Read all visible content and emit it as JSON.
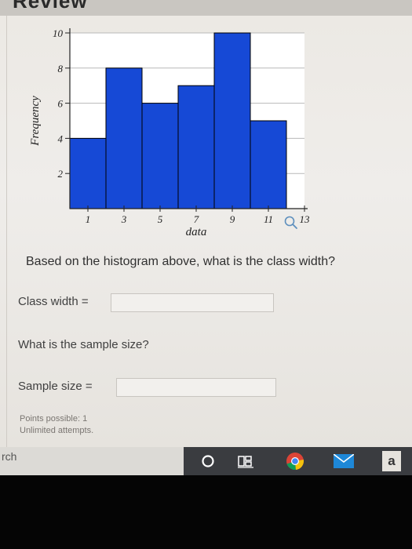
{
  "header": {
    "cut_title": "Review"
  },
  "chart_data": {
    "type": "bar",
    "subtype": "histogram",
    "bin_edges": [
      0,
      2,
      4,
      6,
      8,
      10,
      12
    ],
    "frequencies": [
      4,
      8,
      6,
      7,
      10,
      5
    ],
    "x_ticks": [
      "1",
      "3",
      "5",
      "7",
      "9",
      "11",
      "13"
    ],
    "y_ticks": [
      "2",
      "4",
      "6",
      "8",
      "10"
    ],
    "xlabel": "data",
    "ylabel": "Frequency",
    "ylim": [
      0,
      10
    ],
    "xlim": [
      0,
      13
    ],
    "grid": true,
    "bar_color": "#1649d6",
    "bar_edge": "#000000"
  },
  "magnifier": "magnifier-icon",
  "question1": {
    "text": "Based on the histogram above, what is the class width?"
  },
  "class_width": {
    "label": "Class width =",
    "value": ""
  },
  "question2": {
    "text": "What is the sample size?"
  },
  "sample_size": {
    "label": "Sample size =",
    "value": ""
  },
  "footer": {
    "points": "Points possible: 1",
    "attempts": "Unlimited attempts."
  },
  "taskbar": {
    "search_text": "rch",
    "icons": [
      "cortana-icon",
      "task-view-icon",
      "chrome-icon",
      "mail-icon",
      "store-icon"
    ],
    "store_letter": "a",
    "colors": {
      "bar": "#3a3c40",
      "mail": "#1e88d8",
      "store": "#e6e3dd"
    }
  }
}
